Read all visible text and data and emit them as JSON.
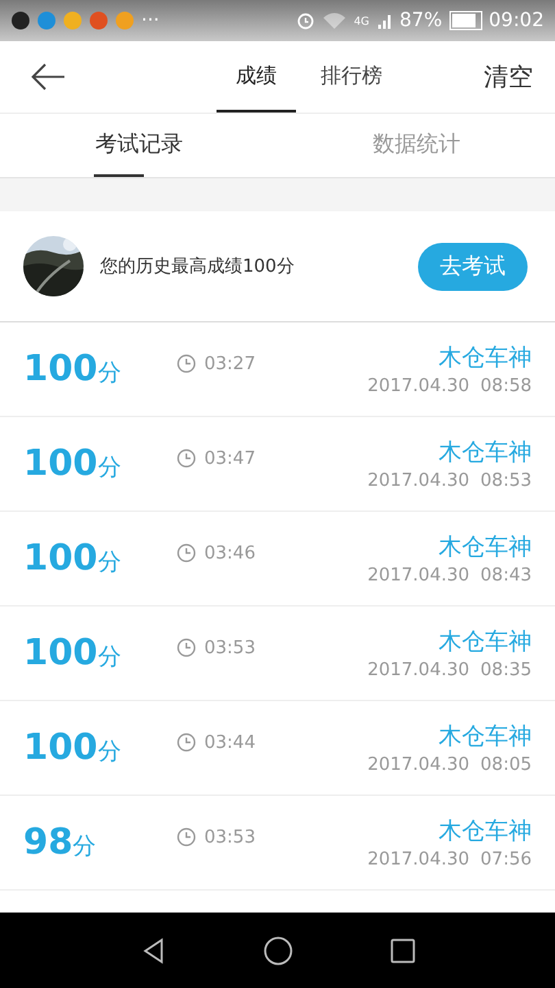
{
  "status_bar": {
    "notifications": [
      {
        "color": "#222222"
      },
      {
        "color": "#1e8fd8"
      },
      {
        "color": "#f0b020"
      },
      {
        "color": "#e05020"
      },
      {
        "color": "#f0a020"
      }
    ],
    "more": "···",
    "network": "4G",
    "battery": "87%",
    "time": "09:02"
  },
  "header": {
    "tabs": [
      {
        "label": "成绩",
        "selected": true
      },
      {
        "label": "排行榜",
        "selected": false
      }
    ],
    "action": "清空"
  },
  "sub_tabs": [
    {
      "label": "考试记录",
      "selected": true
    },
    {
      "label": "数据统计",
      "selected": false
    }
  ],
  "banner": {
    "text": "您的历史最高成绩100分",
    "button": "去考试"
  },
  "records": [
    {
      "score": "100",
      "unit": "分",
      "duration": "03:27",
      "name": "木仓车神",
      "date": "2017.04.30",
      "time": "08:58"
    },
    {
      "score": "100",
      "unit": "分",
      "duration": "03:47",
      "name": "木仓车神",
      "date": "2017.04.30",
      "time": "08:53"
    },
    {
      "score": "100",
      "unit": "分",
      "duration": "03:46",
      "name": "木仓车神",
      "date": "2017.04.30",
      "time": "08:43"
    },
    {
      "score": "100",
      "unit": "分",
      "duration": "03:53",
      "name": "木仓车神",
      "date": "2017.04.30",
      "time": "08:35"
    },
    {
      "score": "100",
      "unit": "分",
      "duration": "03:44",
      "name": "木仓车神",
      "date": "2017.04.30",
      "time": "08:05"
    },
    {
      "score": "98",
      "unit": "分",
      "duration": "03:53",
      "name": "木仓车神",
      "date": "2017.04.30",
      "time": "07:56"
    }
  ]
}
